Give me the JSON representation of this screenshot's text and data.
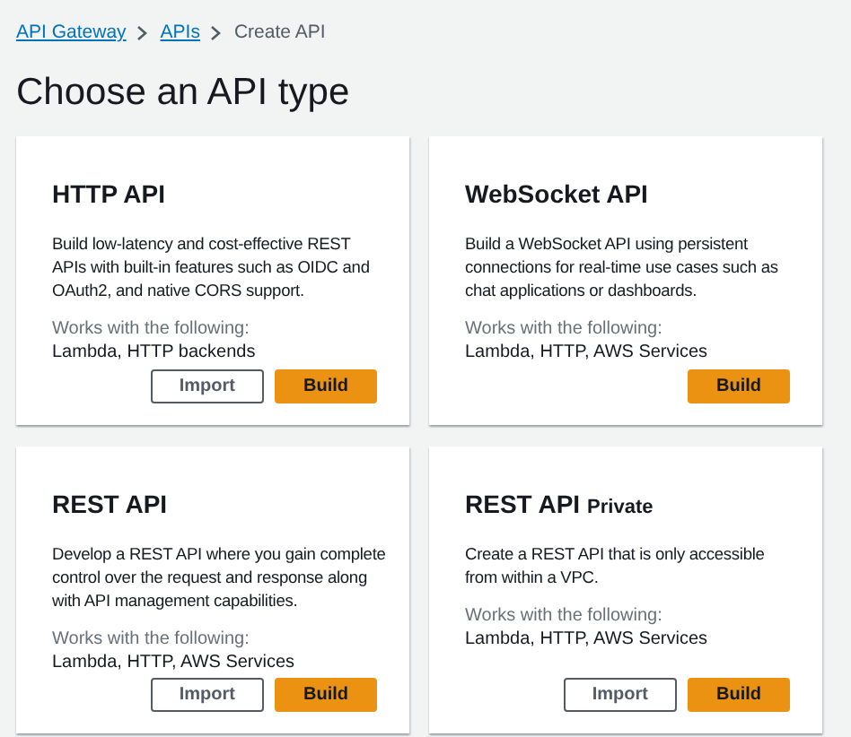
{
  "breadcrumbs": [
    {
      "label": "API Gateway",
      "link": true
    },
    {
      "label": "APIs",
      "link": true
    },
    {
      "label": "Create API",
      "link": false
    }
  ],
  "heading": "Choose an API type",
  "cards": [
    {
      "title": "HTTP API",
      "description": "Build low-latency and cost-effective REST APIs with built-in features such as OIDC and OAuth2, and native CORS support.",
      "works_label": "Works with the following:",
      "works_with": "Lambda, HTTP backends",
      "buttons": [
        {
          "label": "Import",
          "kind": "secondary"
        },
        {
          "label": "Build",
          "kind": "primary"
        }
      ]
    },
    {
      "title": "WebSocket API",
      "description": "Build a WebSocket API using persistent connections for real-time use cases such as chat applications or dashboards.",
      "works_label": "Works with the following:",
      "works_with": "Lambda, HTTP, AWS Services",
      "buttons": [
        {
          "label": "Build",
          "kind": "primary"
        }
      ]
    },
    {
      "title": "REST API",
      "description": "Develop a REST API where you gain complete control over the request and response along with API management capabilities.",
      "works_label": "Works with the following:",
      "works_with": "Lambda, HTTP, AWS Services",
      "buttons": [
        {
          "label": "Import",
          "kind": "secondary"
        },
        {
          "label": "Build",
          "kind": "primary"
        }
      ]
    },
    {
      "title": "REST API",
      "subtitle": "Private",
      "description": "Create a REST API that is only accessible from within a VPC.",
      "works_label": "Works with the following:",
      "works_with": "Lambda, HTTP, AWS Services",
      "buttons": [
        {
          "label": "Import",
          "kind": "secondary"
        },
        {
          "label": "Build",
          "kind": "primary"
        }
      ]
    }
  ]
}
